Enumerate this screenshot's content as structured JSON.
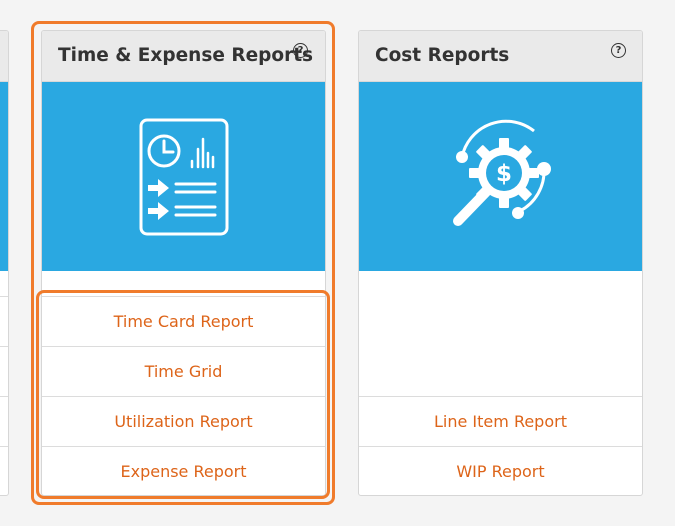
{
  "cards": [
    {
      "title": "Time & Expense Reports",
      "help_icon": "?",
      "icon": "report-document-icon",
      "links": [
        "Time Card Report",
        "Time Grid",
        "Utilization Report",
        "Expense Report"
      ]
    },
    {
      "title": "Cost Reports",
      "help_icon": "?",
      "icon": "cost-analysis-icon",
      "links": [
        "Line Item Report",
        "WIP Report"
      ]
    }
  ],
  "colors": {
    "banner": "#2aa8e1",
    "link_text": "#dd6419",
    "highlight": "#f07b2b",
    "header_bg": "#eaeaea"
  }
}
